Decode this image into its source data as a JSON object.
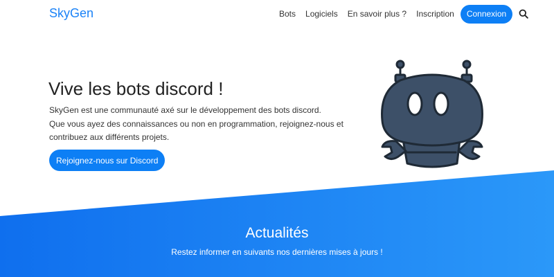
{
  "nav": {
    "brand": "SkyGen",
    "links": [
      "Bots",
      "Logiciels",
      "En savoir plus ?",
      "Inscription"
    ],
    "login": "Connexion",
    "search_icon": "search-icon"
  },
  "hero": {
    "title": "Vive les bots discord !",
    "description": [
      "SkyGen est une communauté axé sur le développement des bots discord.",
      "Que vous ayez des connaissances ou non en programmation, rejoignez-nous et",
      "contribuez aux différents projets."
    ],
    "cta": "Rejoignez-nous sur Discord",
    "mascot": "discord-bot-mascot"
  },
  "news": {
    "title": "Actualités",
    "subtitle": "Restez informer en suivants nos dernières mises à jours !"
  },
  "colors": {
    "brand": "#1a82f7",
    "button": "#0d7ff5",
    "band_left": "#1372ef",
    "band_right": "#2a97f9",
    "mascot_body": "#3d5068",
    "mascot_outline": "#1f2a36"
  }
}
